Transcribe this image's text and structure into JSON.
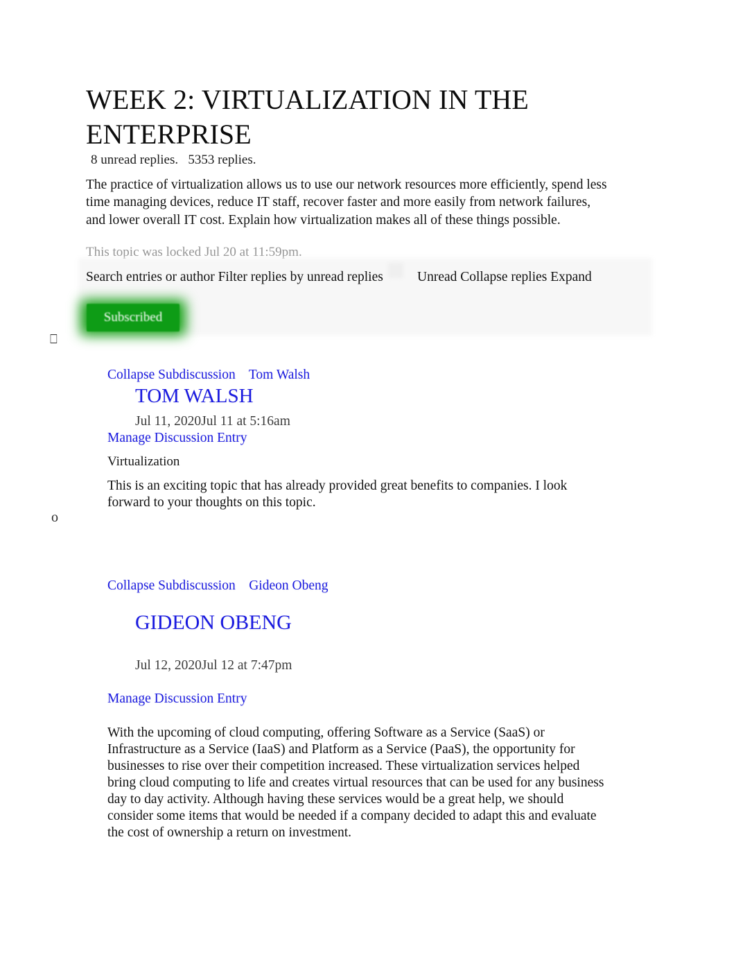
{
  "document": {
    "title": "WEEK 2: VIRTUALIZATION IN THE ENTERPRISE",
    "reply_counts": "8 unread replies.   5353 replies.",
    "prompt": "The practice of virtualization allows us to use our network resources more efficiently, spend less time managing devices, reduce IT staff, recover faster and more easily from network failures, and lower overall IT cost. Explain how virtualization makes all of these things possible.",
    "locked_note": "This topic was locked Jul 20 at 11:59pm."
  },
  "toolbar": {
    "left_text": "Search entries or author Filter replies by unread replies",
    "right_text": "Unread Collapse replies Expand",
    "subscribed_label": "Subscribed",
    "subscribed_color": "#0e9c16"
  },
  "gutter": {
    "tofu_marker": "⎕",
    "bullet_marker": "o"
  },
  "colors": {
    "link": "#1a1ae0",
    "muted_text": "#949494",
    "date_text": "#3b3b3b"
  },
  "entries": [
    {
      "collapse_label": "Collapse Subdiscussion",
      "author_link": "Tom Walsh",
      "author_heading": "TOM WALSH",
      "date": "Jul 11, 2020Jul 11 at 5:16am",
      "manage_label": "Manage Discussion Entry",
      "subject": "Virtualization",
      "body": "This is an exciting topic that has already provided great benefits to companies. I look forward to your thoughts on this topic."
    },
    {
      "collapse_label": "Collapse Subdiscussion",
      "author_link": "Gideon Obeng",
      "author_heading": "GIDEON OBENG",
      "date": "Jul 12, 2020Jul 12 at 7:47pm",
      "manage_label": "Manage Discussion Entry",
      "subject": "",
      "body": "With the upcoming of cloud computing, offering Software as a Service (SaaS) or Infrastructure as a Service (IaaS) and Platform as a Service (PaaS), the opportunity for businesses to rise over their competition increased. These virtualization services helped bring cloud computing to life and creates virtual resources that can be used for any business day to day activity. Although having these services would be a great help, we should consider some items that would be needed if a company decided to adapt this and evaluate the cost of ownership a return on investment."
    }
  ]
}
